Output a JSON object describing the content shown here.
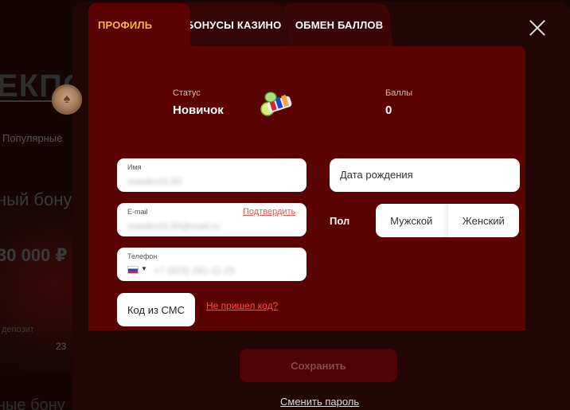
{
  "background": {
    "title": "ЕКПО",
    "tab_popular": "Популярные",
    "bonus_text": "ный бону",
    "amount_text": "30 000 ₽",
    "small_text_1": "депозит",
    "small_text_2": "23",
    "bottom_text": "ные бону"
  },
  "tabs": [
    {
      "label": "ПРОФИЛЬ",
      "active": true
    },
    {
      "label": "БОНУСЫ КАЗИНО",
      "active": false
    },
    {
      "label": "ОБМЕН БАЛЛОВ",
      "active": false
    }
  ],
  "status": {
    "label": "Статус",
    "value": "Новичок",
    "icon": "poker-chip-icon"
  },
  "points": {
    "label": "Баллы",
    "value": "0",
    "icon": "chips-stack-icon"
  },
  "fields": {
    "name": {
      "label": "Имя",
      "value": "masiko15.93"
    },
    "email": {
      "label": "E-mail",
      "value": "masiko15.93@mail.ru",
      "confirm_link": "Подтвердить"
    },
    "phone": {
      "label": "Телефон",
      "value": "+7 (923) 281-11-25"
    },
    "birthdate": {
      "placeholder": "Дата рождения"
    }
  },
  "gender": {
    "label": "Пол",
    "male": "Мужской",
    "female": "Женский"
  },
  "sms": {
    "button_label": "Код из СМС",
    "resend_link": "Не пришел код?"
  },
  "actions": {
    "save_label": "Сохранить",
    "change_password_label": "Сменить пароль"
  },
  "colors": {
    "accent": "#f7b343",
    "panel": "#5b0202",
    "link": "#ff4d4d"
  }
}
